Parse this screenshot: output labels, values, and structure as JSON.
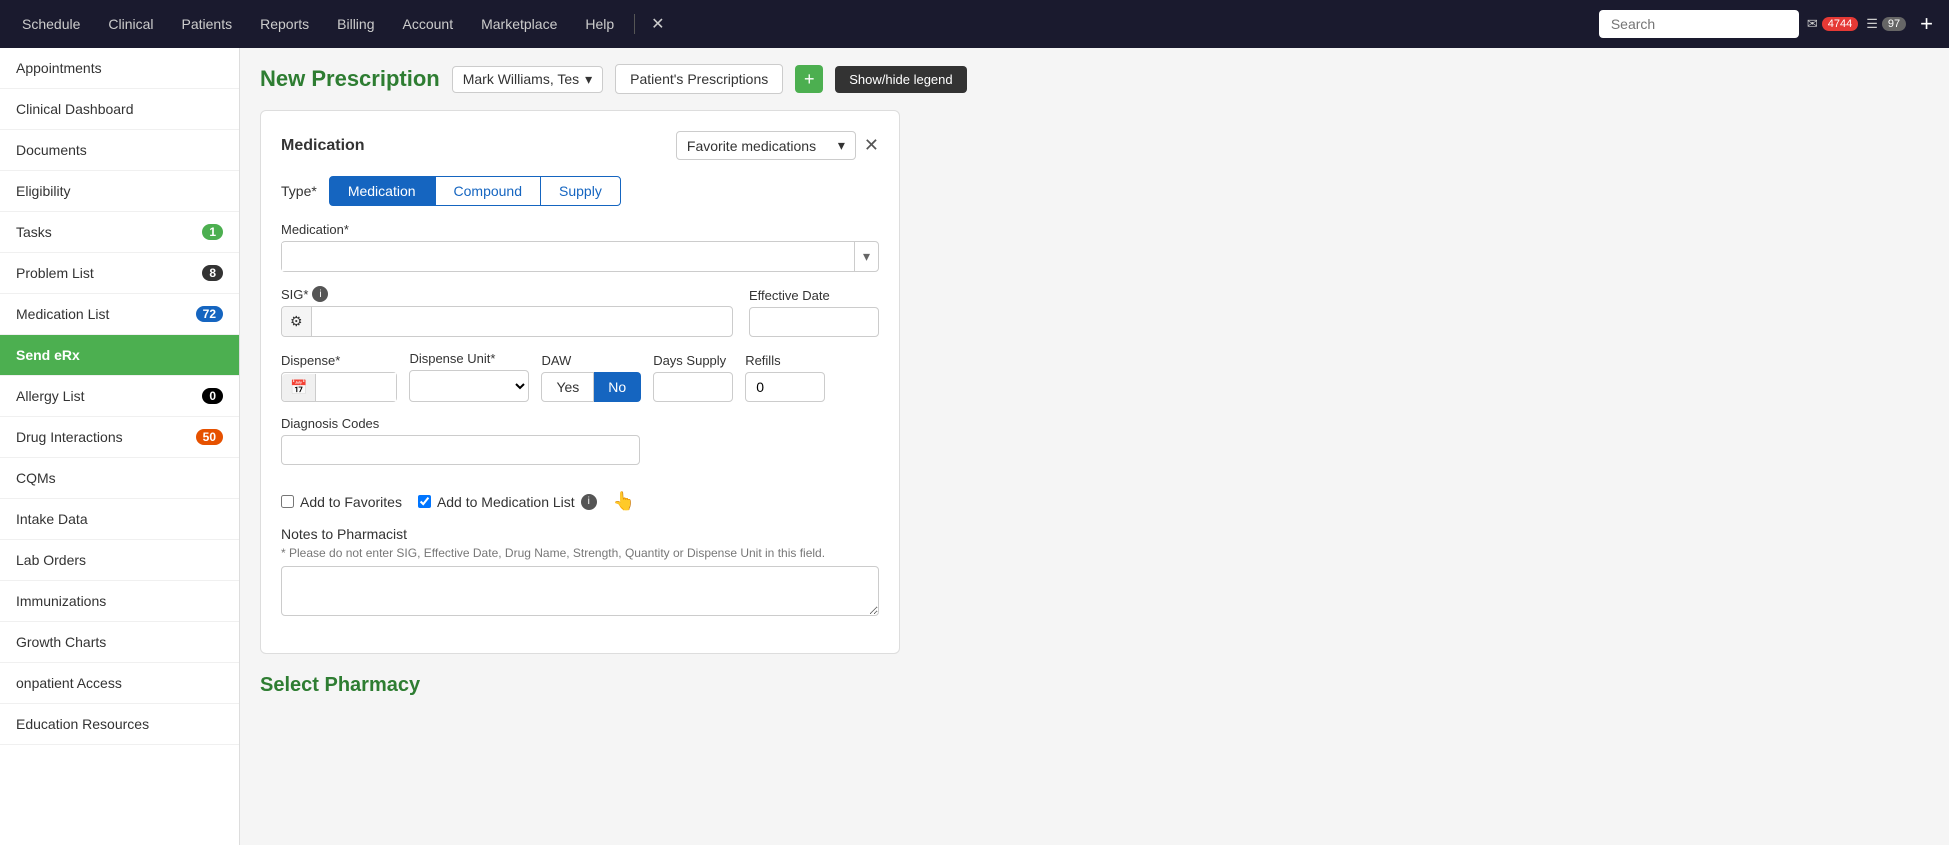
{
  "topnav": {
    "items": [
      {
        "label": "Schedule",
        "id": "schedule"
      },
      {
        "label": "Clinical",
        "id": "clinical"
      },
      {
        "label": "Patients",
        "id": "patients"
      },
      {
        "label": "Reports",
        "id": "reports"
      },
      {
        "label": "Billing",
        "id": "billing"
      },
      {
        "label": "Account",
        "id": "account"
      },
      {
        "label": "Marketplace",
        "id": "marketplace"
      },
      {
        "label": "Help",
        "id": "help"
      }
    ],
    "search_placeholder": "Search",
    "badge_mail": "4744",
    "badge_notif": "97"
  },
  "sidebar": {
    "items": [
      {
        "label": "Appointments",
        "badge": null,
        "active": false
      },
      {
        "label": "Clinical Dashboard",
        "badge": null,
        "active": false
      },
      {
        "label": "Documents",
        "badge": null,
        "active": false
      },
      {
        "label": "Eligibility",
        "badge": null,
        "active": false
      },
      {
        "label": "Tasks",
        "badge": "1",
        "badge_type": "green",
        "active": false
      },
      {
        "label": "Problem List",
        "badge": "8",
        "badge_type": "dark",
        "active": false
      },
      {
        "label": "Medication List",
        "badge": "72",
        "badge_type": "blue",
        "active": false
      },
      {
        "label": "Send eRx",
        "badge": null,
        "active": true
      },
      {
        "label": "Allergy List",
        "badge": "0",
        "badge_type": "black",
        "active": false
      },
      {
        "label": "Drug Interactions",
        "badge": "50",
        "badge_type": "orange",
        "active": false
      },
      {
        "label": "CQMs",
        "badge": null,
        "active": false
      },
      {
        "label": "Intake Data",
        "badge": null,
        "active": false
      },
      {
        "label": "Lab Orders",
        "badge": null,
        "active": false
      },
      {
        "label": "Immunizations",
        "badge": null,
        "active": false
      },
      {
        "label": "Growth Charts",
        "badge": null,
        "active": false
      },
      {
        "label": "onpatient Access",
        "badge": null,
        "active": false
      },
      {
        "label": "Education Resources",
        "badge": null,
        "active": false
      }
    ]
  },
  "page": {
    "title": "New Prescription",
    "patient_name": "Mark Williams, Tes",
    "patient_prescriptions_label": "Patient's Prescriptions",
    "legend_label": "Show/hide legend",
    "medication_card": {
      "title": "Medication",
      "favorite_placeholder": "Favorite medications",
      "type_label": "Type*",
      "types": [
        "Medication",
        "Compound",
        "Supply"
      ],
      "active_type": "Medication",
      "medication_label": "Medication*",
      "sig_label": "SIG*",
      "effective_date_label": "Effective Date",
      "dispense_label": "Dispense*",
      "dispense_unit_label": "Dispense Unit*",
      "daw_label": "DAW",
      "daw_yes": "Yes",
      "daw_no": "No",
      "active_daw": "No",
      "days_supply_label": "Days Supply",
      "refills_label": "Refills",
      "refills_value": "0",
      "diagnosis_codes_label": "Diagnosis Codes",
      "add_to_favorites_label": "Add to Favorites",
      "add_to_medication_list_label": "Add to Medication List",
      "add_to_favorites_checked": false,
      "add_to_medication_list_checked": true,
      "notes_label": "Notes to Pharmacist",
      "notes_hint": "* Please do not enter SIG, Effective Date, Drug Name, Strength, Quantity or Dispense Unit in this field."
    },
    "select_pharmacy_title": "Select Pharmacy"
  }
}
